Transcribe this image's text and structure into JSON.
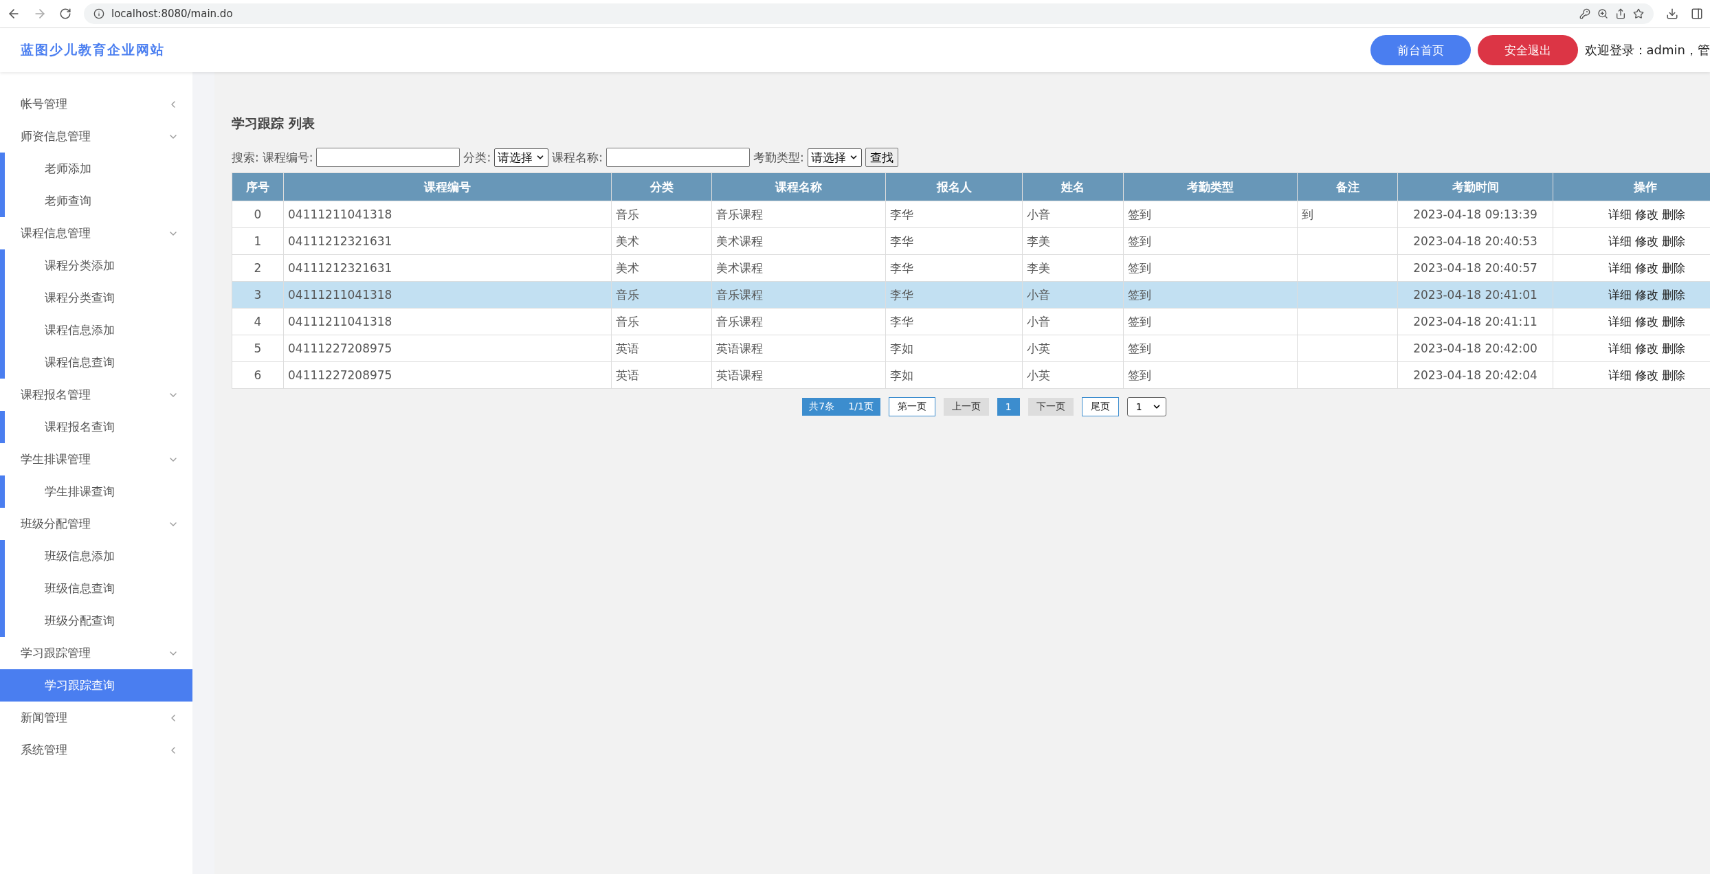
{
  "browser": {
    "url": "localhost:8080/main.do"
  },
  "header": {
    "title": "蓝图少儿教育企业网站",
    "buttons": [
      {
        "label": "前台首页",
        "kind": "primary"
      },
      {
        "label": "安全退出",
        "kind": "danger"
      }
    ],
    "welcome": "欢迎登录：admin，管"
  },
  "sidebar": {
    "items": [
      {
        "label": "帐号管理",
        "expanded": false
      },
      {
        "label": "师资信息管理",
        "expanded": true,
        "children": [
          {
            "label": "老师添加",
            "selected": false
          },
          {
            "label": "老师查询",
            "selected": false
          }
        ]
      },
      {
        "label": "课程信息管理",
        "expanded": true,
        "children": [
          {
            "label": "课程分类添加",
            "selected": false
          },
          {
            "label": "课程分类查询",
            "selected": false
          },
          {
            "label": "课程信息添加",
            "selected": false
          },
          {
            "label": "课程信息查询",
            "selected": false
          }
        ]
      },
      {
        "label": "课程报名管理",
        "expanded": true,
        "children": [
          {
            "label": "课程报名查询",
            "selected": false
          }
        ]
      },
      {
        "label": "学生排课管理",
        "expanded": true,
        "children": [
          {
            "label": "学生排课查询",
            "selected": false
          }
        ]
      },
      {
        "label": "班级分配管理",
        "expanded": true,
        "children": [
          {
            "label": "班级信息添加",
            "selected": false
          },
          {
            "label": "班级信息查询",
            "selected": false
          },
          {
            "label": "班级分配查询",
            "selected": false
          }
        ]
      },
      {
        "label": "学习跟踪管理",
        "expanded": true,
        "children": [
          {
            "label": "学习跟踪查询",
            "selected": true
          }
        ]
      },
      {
        "label": "新闻管理",
        "expanded": false
      },
      {
        "label": "系统管理",
        "expanded": false
      }
    ]
  },
  "page_title": "学习跟踪 列表",
  "search": {
    "items": [
      {
        "kind": "label",
        "text": "搜索:"
      },
      {
        "kind": "label",
        "text": "课程编号:"
      },
      {
        "kind": "input"
      },
      {
        "kind": "label",
        "text": "分类:"
      },
      {
        "kind": "select",
        "value": "请选择"
      },
      {
        "kind": "label",
        "text": "课程名称:"
      },
      {
        "kind": "input"
      },
      {
        "kind": "label",
        "text": "考勤类型:"
      },
      {
        "kind": "select",
        "value": "请选择"
      },
      {
        "kind": "button",
        "text": "查找"
      }
    ]
  },
  "table": {
    "columns": [
      "序号",
      "课程编号",
      "分类",
      "课程名称",
      "报名人",
      "姓名",
      "考勤类型",
      "备注",
      "考勤时间",
      "操作"
    ],
    "rows": [
      {
        "cells": [
          "0",
          "04111211041318",
          "音乐",
          "音乐课程",
          "李华",
          "小音",
          "签到",
          "到",
          "2023-04-18 09:13:39"
        ],
        "actions": [
          "详细",
          "修改",
          "删除"
        ],
        "selected": false
      },
      {
        "cells": [
          "1",
          "04111212321631",
          "美术",
          "美术课程",
          "李华",
          "李美",
          "签到",
          "",
          "2023-04-18 20:40:53"
        ],
        "actions": [
          "详细",
          "修改",
          "删除"
        ],
        "selected": false
      },
      {
        "cells": [
          "2",
          "04111212321631",
          "美术",
          "美术课程",
          "李华",
          "李美",
          "签到",
          "",
          "2023-04-18 20:40:57"
        ],
        "actions": [
          "详细",
          "修改",
          "删除"
        ],
        "selected": false
      },
      {
        "cells": [
          "3",
          "04111211041318",
          "音乐",
          "音乐课程",
          "李华",
          "小音",
          "签到",
          "",
          "2023-04-18 20:41:01"
        ],
        "actions": [
          "详细",
          "修改",
          "删除"
        ],
        "selected": true
      },
      {
        "cells": [
          "4",
          "04111211041318",
          "音乐",
          "音乐课程",
          "李华",
          "小音",
          "签到",
          "",
          "2023-04-18 20:41:11"
        ],
        "actions": [
          "详细",
          "修改",
          "删除"
        ],
        "selected": false
      },
      {
        "cells": [
          "5",
          "04111227208975",
          "英语",
          "英语课程",
          "李如",
          "小英",
          "签到",
          "",
          "2023-04-18 20:42:00"
        ],
        "actions": [
          "详细",
          "修改",
          "删除"
        ],
        "selected": false
      },
      {
        "cells": [
          "6",
          "04111227208975",
          "英语",
          "英语课程",
          "李如",
          "小英",
          "签到",
          "",
          "2023-04-18 20:42:04"
        ],
        "actions": [
          "详细",
          "修改",
          "删除"
        ],
        "selected": false
      }
    ]
  },
  "pagination": {
    "summary": [
      "共7条",
      "1/1页"
    ],
    "buttons": [
      {
        "label": "第一页",
        "kind": "link"
      },
      {
        "label": "上一页",
        "kind": "disabled"
      },
      {
        "label": "1",
        "kind": "current"
      },
      {
        "label": "下一页",
        "kind": "disabled"
      },
      {
        "label": "尾页",
        "kind": "link"
      }
    ],
    "page_select": "1"
  }
}
